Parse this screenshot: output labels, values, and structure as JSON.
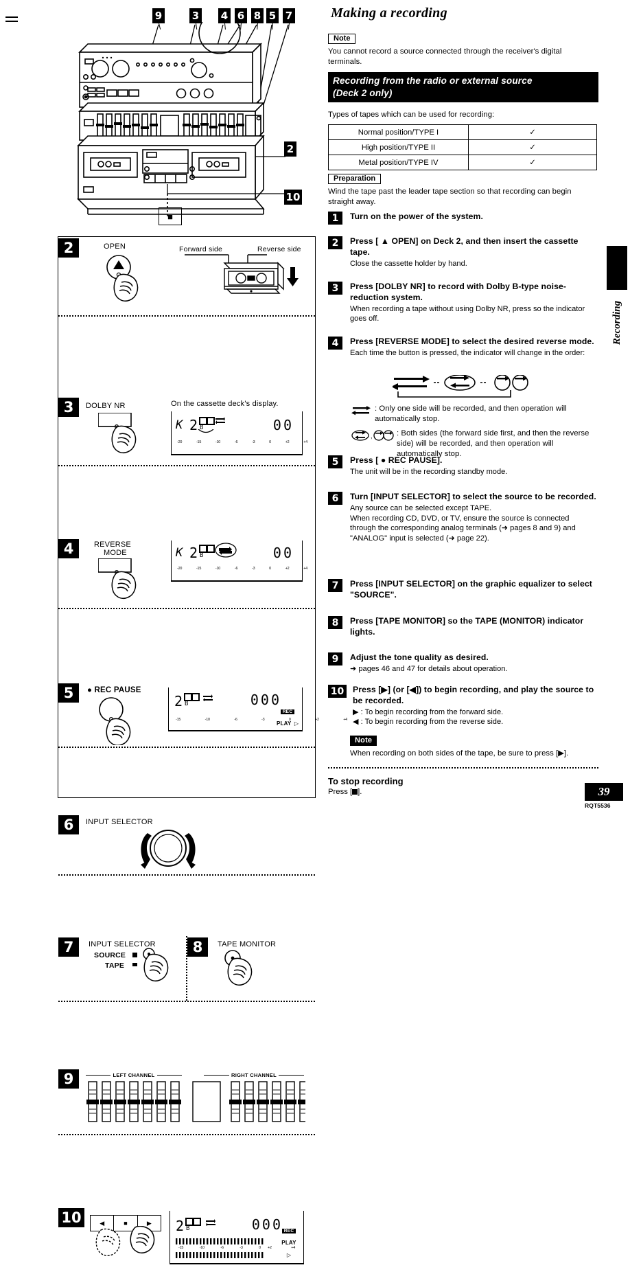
{
  "page": {
    "number": "39",
    "model_code": "RQT5536",
    "side_tab_label": "Recording"
  },
  "header": {
    "title": "Making a recording"
  },
  "note_top": {
    "label": "Note",
    "text": "You cannot record a source connected through the receiver's digital terminals."
  },
  "section_banner": {
    "line1": "Recording from the radio or external source",
    "line2": "(Deck 2 only)"
  },
  "tape_types": {
    "intro": "Types of tapes which can be used for recording:",
    "rows": [
      {
        "name": "Normal position/TYPE  I",
        "supported": "✓"
      },
      {
        "name": "High position/TYPE  II",
        "supported": "✓"
      },
      {
        "name": "Metal position/TYPE  IV",
        "supported": "✓"
      }
    ]
  },
  "preparation": {
    "label": "Preparation",
    "text": "Wind the tape past the leader tape section so that recording can begin straight away."
  },
  "steps": [
    {
      "num": "1",
      "head": "Turn on the power of the system.",
      "sub": ""
    },
    {
      "num": "2",
      "head": "Press [ ▲ OPEN] on Deck 2, and then insert the cassette tape.",
      "sub": "Close the cassette holder by hand."
    },
    {
      "num": "3",
      "head": "Press [DOLBY NR] to record with Dolby B-type noise-reduction system.",
      "sub": "When recording a tape without using Dolby NR, press so the indicator goes off."
    },
    {
      "num": "4",
      "head": "Press [REVERSE MODE] to select the desired reverse mode.",
      "sub": "Each time the button is pressed, the indicator will change in the order:"
    },
    {
      "num": "5",
      "head": "Press [ ● REC PAUSE].",
      "sub": "The unit will be in the recording standby mode."
    },
    {
      "num": "6",
      "head": "Turn [INPUT SELECTOR] to select the source to be recorded.",
      "sub": "Any source can be selected except TAPE.\nWhen recording CD, DVD, or TV, ensure the source is connected through the corresponding analog terminals (➜ pages 8 and 9) and \"ANALOG\" input is selected (➜ page 22)."
    },
    {
      "num": "7",
      "head": "Press [INPUT SELECTOR] on the graphic equalizer to select \"SOURCE\".",
      "sub": ""
    },
    {
      "num": "8",
      "head": "Press [TAPE MONITOR] so the TAPE (MONITOR) indicator lights.",
      "sub": ""
    },
    {
      "num": "9",
      "head": "Adjust the tone quality as desired.",
      "sub": "➜ pages 46 and 47 for details about operation."
    },
    {
      "num": "10",
      "head": "Press  [▶] (or [◀]) to begin recording, and play the source to be recorded.",
      "sub": "▶ : To begin recording from the forward side.\n◀ : To begin recording from the reverse side."
    }
  ],
  "reverse_mode_legend": {
    "one_side": ": Only one side will be recorded, and then operation will automatically stop.",
    "both_sides": ": Both sides (the forward side first, and then the reverse side) will be recorded, and then operation will automatically stop."
  },
  "note_bottom": {
    "label": "Note",
    "text": "When recording on both sides of the tape, be sure to press [▶]."
  },
  "stop_recording": {
    "heading": "To stop recording",
    "text_prefix": "Press [",
    "text_suffix": "]."
  },
  "diagram": {
    "top_callouts": [
      "9",
      "3",
      "4",
      "6",
      "8",
      "5",
      "7"
    ],
    "right_callouts": [
      "2",
      "10"
    ],
    "remote_symbol": "■"
  },
  "panels": [
    {
      "num": "2",
      "button_label": "OPEN",
      "cassette": {
        "forward_label": "Forward side",
        "reverse_label": "Reverse side"
      }
    },
    {
      "num": "3",
      "button_label": "DOLBY NR",
      "display_caption": "On the cassette deck's display.",
      "lcd": {
        "deck": "2",
        "prefix": "K",
        "dolby": "B",
        "counter": "00",
        "scale": [
          "-20",
          "-15",
          "-10",
          "-6",
          "-3",
          "0",
          "+2",
          "+4"
        ]
      }
    },
    {
      "num": "4",
      "button_label_line1": "REVERSE",
      "button_label_line2": "MODE",
      "lcd": {
        "deck": "2",
        "prefix": "K",
        "dolby": "B",
        "counter": "00",
        "scale": [
          "-20",
          "-15",
          "-10",
          "-6",
          "-3",
          "0",
          "+2",
          "+4"
        ]
      }
    },
    {
      "num": "5",
      "button_label": "● REC PAUSE",
      "lcd": {
        "deck": "2",
        "dolby": "B",
        "counter": "000",
        "scale": [
          "-15",
          "-10",
          "-6",
          "-3",
          "0",
          "+2",
          "+4"
        ],
        "rec_badge": "REC",
        "play_text": "PLAY"
      }
    },
    {
      "num": "6",
      "knob_label": "INPUT SELECTOR"
    },
    {
      "num": "7",
      "label": "INPUT  SELECTOR",
      "option_source": "SOURCE",
      "option_tape": "TAPE"
    },
    {
      "num": "8",
      "label": "TAPE MONITOR"
    },
    {
      "num": "9",
      "left_channel": "LEFT CHANNEL",
      "right_channel": "RIGHT CHANNEL"
    },
    {
      "num": "10",
      "buttons": [
        "◀",
        "■",
        "▶"
      ],
      "lcd": {
        "deck": "2",
        "dolby": "B",
        "counter": "000",
        "scale": [
          "-15",
          "-10",
          "-6",
          "-3",
          "0",
          "+2",
          "+4"
        ],
        "rec_badge": "REC",
        "play_text": "PLAY"
      }
    }
  ]
}
